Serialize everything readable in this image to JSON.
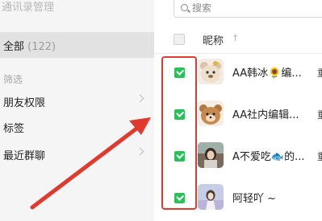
{
  "sidebar": {
    "title": "通讯录管理",
    "all": {
      "label": "全部",
      "count": "(122)"
    },
    "filter_label": "筛选",
    "items": [
      {
        "label": "朋友权限",
        "has_chevron": true
      },
      {
        "label": "标签",
        "has_chevron": false
      },
      {
        "label": "最近群聊",
        "has_chevron": true
      }
    ]
  },
  "search": {
    "placeholder": "搜索"
  },
  "table": {
    "header": {
      "label": "昵称",
      "sort_glyph": "↑"
    },
    "rows": [
      {
        "name": "AA韩冰🌻编...",
        "checked": true,
        "avatar_icon": "bear-avatar",
        "edge_text": "重"
      },
      {
        "name": "AA社内编辑...",
        "checked": true,
        "avatar_icon": "bear-avatar",
        "edge_text": "重"
      },
      {
        "name": "A不爱吃🐟的...",
        "checked": true,
        "avatar_icon": "girl-avatar",
        "edge_text": "重"
      },
      {
        "name": "阿轻吖 ~",
        "checked": true,
        "avatar_icon": "girl-avatar",
        "edge_text": ""
      }
    ]
  },
  "colors": {
    "check": "#2bc05a",
    "annotation": "#e03a2f"
  }
}
